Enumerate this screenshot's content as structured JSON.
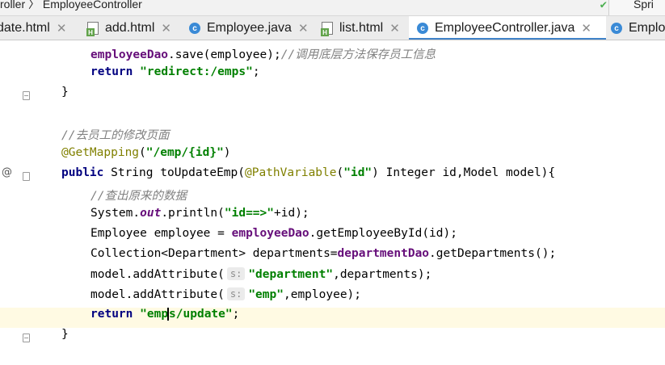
{
  "breadcrumb": {
    "text": "roller 〉 EmployeeController",
    "right_label": "Spri"
  },
  "tabs": [
    {
      "label": "date.html",
      "icon": "html-file-icon",
      "active": false
    },
    {
      "label": "add.html",
      "icon": "html-file-icon",
      "active": false
    },
    {
      "label": "Employee.java",
      "icon": "java-class-icon",
      "active": false
    },
    {
      "label": "list.html",
      "icon": "html-file-icon",
      "active": false
    },
    {
      "label": "EmployeeController.java",
      "icon": "java-class-icon",
      "active": true
    },
    {
      "label": "Employ",
      "icon": "java-class-icon",
      "active": false
    }
  ],
  "code": {
    "l1": {
      "a": "employeeDao",
      "b": ".save(employee);",
      "c": "//调用底层方法保存员工信息"
    },
    "l2": {
      "kw": "return",
      "str": "\"redirect:/emps\"",
      "end": ";"
    },
    "l3": {
      "t": "}"
    },
    "l5": {
      "c": "//去员工的修改页面"
    },
    "l6": {
      "ann": "@GetMapping",
      "p1": "(",
      "str": "\"/emp/{id}\"",
      "p2": ")"
    },
    "l7": {
      "kw": "public",
      "t1": " String toUpdateEmp(",
      "ann": "@PathVariable",
      "p1": "(",
      "str": "\"id\"",
      "t2": ") Integer id,Model model){"
    },
    "l8": {
      "c": "//查出原来的数据"
    },
    "l9": {
      "t1": "System.",
      "fld": "out",
      "t2": ".println(",
      "str": "\"id==>\"",
      "t3": "+id);"
    },
    "l10": {
      "t1": "Employee employee = ",
      "fld": "employeeDao",
      "t2": ".getEmployeeById(id);"
    },
    "l11": {
      "t1": "Collection<Department> departments=",
      "fld": "departmentDao",
      "t2": ".getDepartments();"
    },
    "l12": {
      "t1": "model.addAttribute(",
      "hint": "s:",
      "str": "\"department\"",
      "t2": ",departments);"
    },
    "l13": {
      "t1": "model.addAttribute(",
      "hint": "s:",
      "str": "\"emp\"",
      "t2": ",employee);"
    },
    "l14": {
      "kw": "return",
      "s1": "\"emp",
      "s2": "s/update\"",
      "end": ";"
    },
    "l15": {
      "t": "}"
    }
  }
}
